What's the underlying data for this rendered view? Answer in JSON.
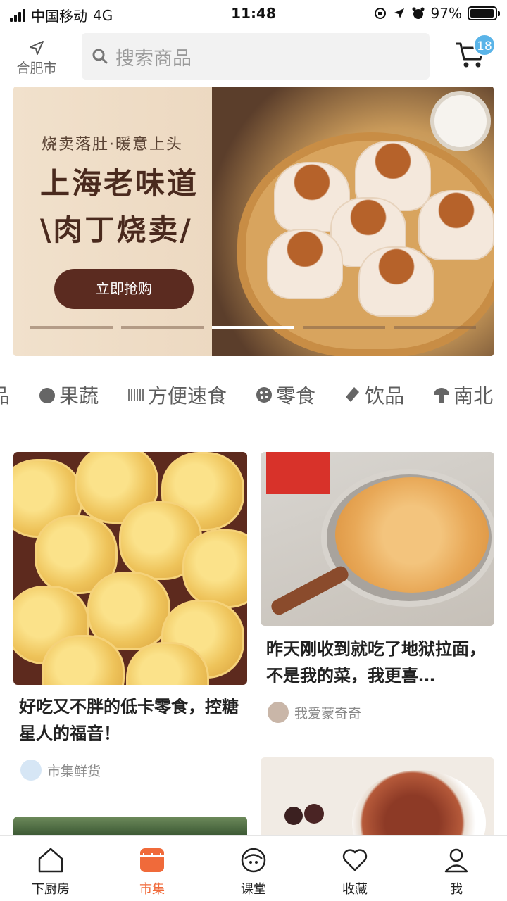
{
  "status_bar": {
    "carrier": "中国移动",
    "network": "4G",
    "time": "11:48",
    "battery": "97%",
    "battery_level": 0.97
  },
  "header": {
    "location": "合肥市",
    "search_placeholder": "搜索商品",
    "cart_count": "18"
  },
  "banner": {
    "subtitle": "烧卖落肚·暖意上头",
    "title_line1": "上海老味道",
    "title_line2": "\\肉丁烧卖/",
    "cta": "立即抢购",
    "carousel_index": 3,
    "carousel_total": 5
  },
  "categories": [
    {
      "label": "品",
      "icon": "partial-icon"
    },
    {
      "label": "果蔬",
      "icon": "fruit-icon"
    },
    {
      "label": "方便速食",
      "icon": "noodle-icon"
    },
    {
      "label": "零食",
      "icon": "cookie-icon"
    },
    {
      "label": "饮品",
      "icon": "bottle-icon"
    },
    {
      "label": "南北",
      "icon": "mushroom-icon"
    }
  ],
  "feed": [
    {
      "title": "好吃又不胖的低卡零食，控糖星人的福音！",
      "author": "市集鲜货"
    },
    {
      "title": "昨天刚收到就吃了地狱拉面，不是我的菜，我更喜…",
      "author": "我爱蒙奇奇"
    }
  ],
  "tabs": [
    {
      "label": "下厨房",
      "icon": "home-icon",
      "active": false
    },
    {
      "label": "市集",
      "icon": "market-icon",
      "active": true
    },
    {
      "label": "课堂",
      "icon": "class-icon",
      "active": false
    },
    {
      "label": "收藏",
      "icon": "heart-icon",
      "active": false
    },
    {
      "label": "我",
      "icon": "user-icon",
      "active": false
    }
  ],
  "colors": {
    "accent": "#f06a3a",
    "badge": "#5ab4e8",
    "cta": "#5b2b20"
  }
}
